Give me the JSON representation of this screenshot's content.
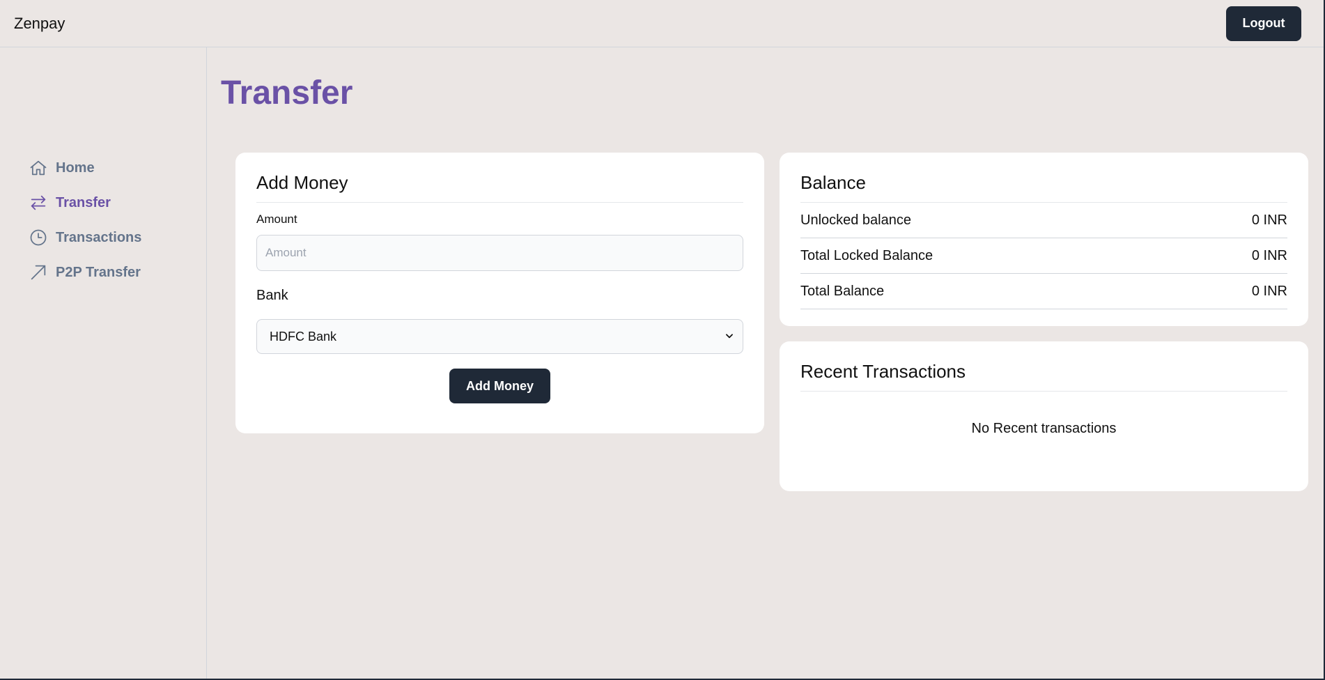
{
  "header": {
    "brand": "Zenpay",
    "logout_label": "Logout"
  },
  "sidebar": {
    "items": [
      {
        "label": "Home",
        "icon": "home-icon",
        "active": false
      },
      {
        "label": "Transfer",
        "icon": "transfer-arrows-icon",
        "active": true
      },
      {
        "label": "Transactions",
        "icon": "clock-icon",
        "active": false
      },
      {
        "label": "P2P Transfer",
        "icon": "arrow-up-right-icon",
        "active": false
      }
    ]
  },
  "main": {
    "title": "Transfer",
    "add_money": {
      "title": "Add Money",
      "amount_label": "Amount",
      "amount_placeholder": "Amount",
      "amount_value": "",
      "bank_label": "Bank",
      "bank_selected": "HDFC Bank",
      "button_label": "Add Money"
    },
    "balance": {
      "title": "Balance",
      "rows": [
        {
          "label": "Unlocked balance",
          "value": "0 INR"
        },
        {
          "label": "Total Locked Balance",
          "value": "0 INR"
        },
        {
          "label": "Total Balance",
          "value": "0 INR"
        }
      ]
    },
    "recent": {
      "title": "Recent Transactions",
      "empty_message": "No Recent transactions"
    }
  },
  "colors": {
    "accent": "#6a51a6",
    "muted": "#64748b",
    "button": "#1f2937",
    "background": "#ebe6e4"
  }
}
